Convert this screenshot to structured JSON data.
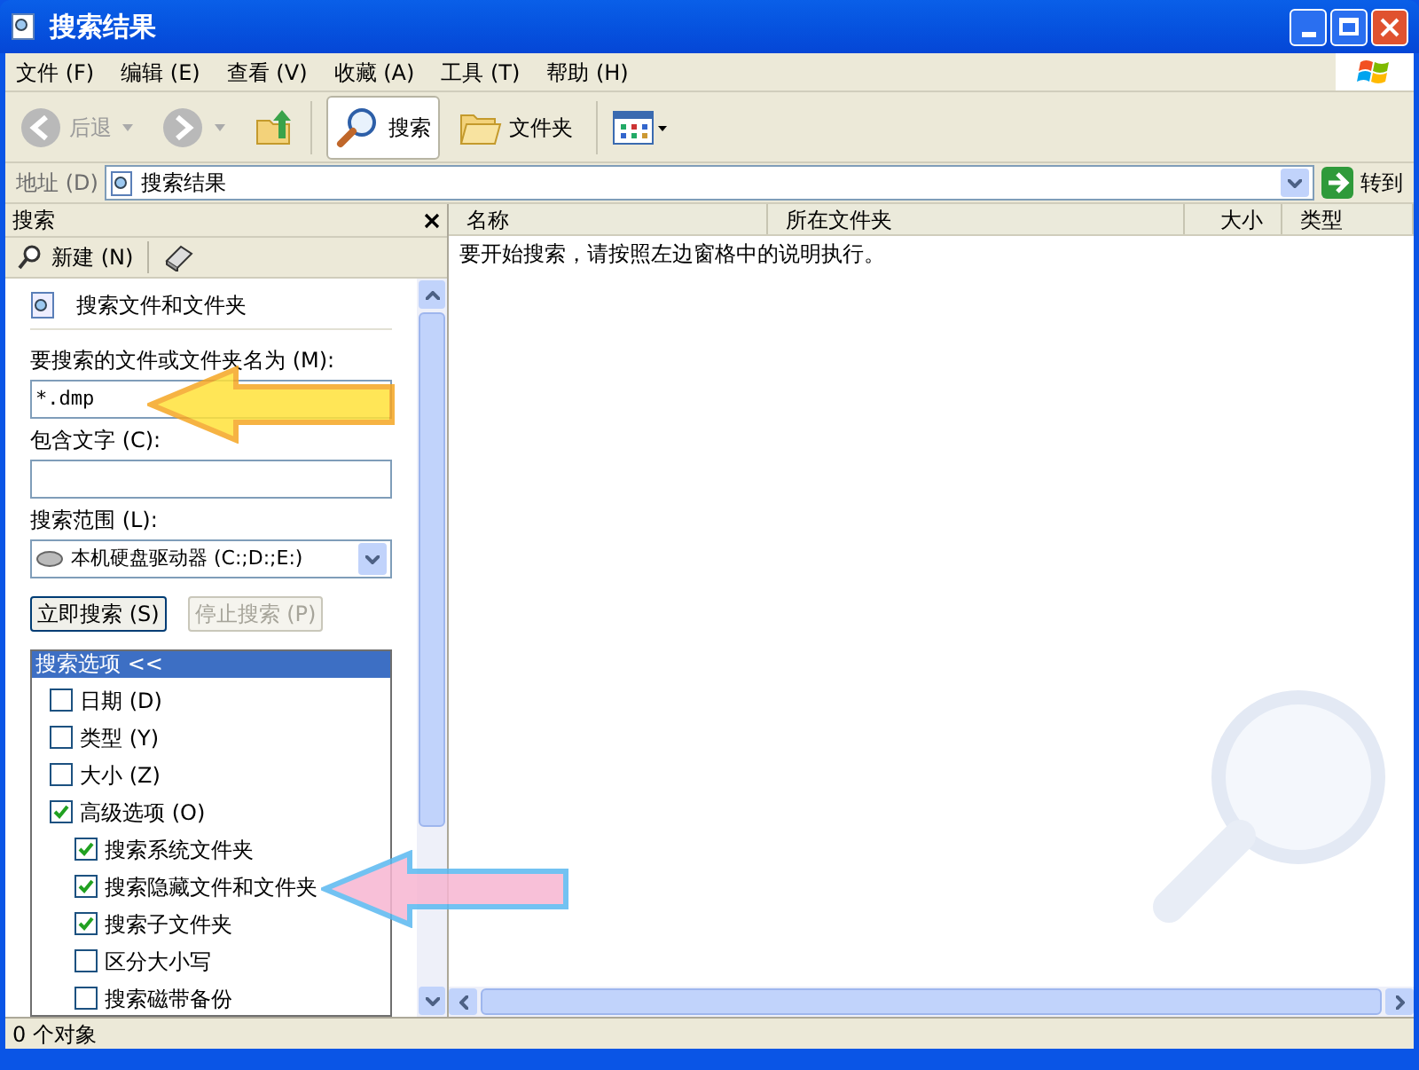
{
  "window": {
    "title": "搜索结果"
  },
  "menu": [
    "文件 (F)",
    "编辑 (E)",
    "查看 (V)",
    "收藏 (A)",
    "工具 (T)",
    "帮助 (H)"
  ],
  "toolbar": {
    "back": {
      "label": "后退",
      "disabled": true
    },
    "search": {
      "label": "搜索",
      "selected": true
    },
    "folders": {
      "label": "文件夹",
      "selected": false
    }
  },
  "address": {
    "label": "地址 (D)",
    "value": "搜索结果",
    "go": "转到"
  },
  "search_pane": {
    "title": "搜索",
    "new_button": "新建 (N)",
    "section_title": "搜索文件和文件夹",
    "name_label": "要搜索的文件或文件夹名为 (M):",
    "name_value": "*.dmp",
    "text_label": "包含文字 (C):",
    "scope_label": "搜索范围 (L):",
    "scope_value": "本机硬盘驱动器 (C:;D:;E:)",
    "buttons": [
      {
        "label": "立即搜索 (S)",
        "disabled": false
      },
      {
        "label": "停止搜索 (P)",
        "disabled": true
      }
    ],
    "options_header": "搜索选项 <<",
    "options": [
      {
        "label": "日期 (D)",
        "checked": false
      },
      {
        "label": "类型 (Y)",
        "checked": false
      },
      {
        "label": "大小 (Z)",
        "checked": false
      },
      {
        "label": "高级选项 (O)",
        "checked": true,
        "children": [
          {
            "label": "搜索系统文件夹",
            "checked": true
          },
          {
            "label": "搜索隐藏文件和文件夹",
            "checked": true
          },
          {
            "label": "搜索子文件夹",
            "checked": true
          },
          {
            "label": "区分大小写",
            "checked": false
          },
          {
            "label": "搜索磁带备份",
            "checked": false
          }
        ]
      }
    ]
  },
  "results": {
    "columns": [
      "名称",
      "所在文件夹",
      "大小",
      "类型"
    ],
    "message": "要开始搜索，请按照左边窗格中的说明执行。"
  },
  "status_bar": "0 个对象"
}
